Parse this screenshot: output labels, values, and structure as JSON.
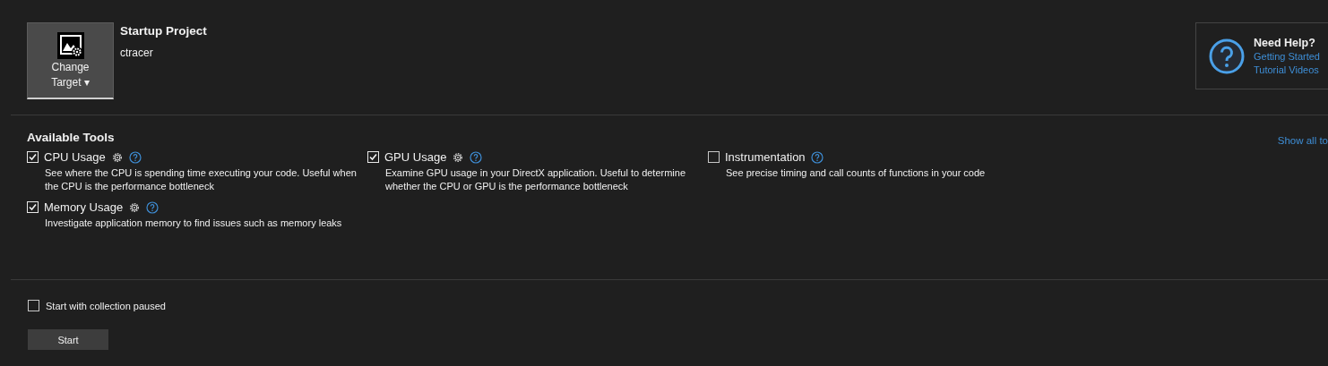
{
  "target": {
    "button_label_line1": "Change",
    "button_label_line2": "Target",
    "caret": "▾",
    "heading": "Startup Project",
    "project": "ctracer"
  },
  "help": {
    "title": "Need Help?",
    "links": [
      "Getting Started",
      "Tutorial Videos"
    ]
  },
  "tools_section": {
    "title": "Available Tools",
    "show_all_link": "Show all to"
  },
  "tools": [
    {
      "name": "CPU Usage",
      "checked": true,
      "has_settings": true,
      "description": "See where the CPU is spending time executing your code. Useful when the CPU is the performance bottleneck"
    },
    {
      "name": "GPU Usage",
      "checked": true,
      "has_settings": true,
      "description": "Examine GPU usage in your DirectX application. Useful to determine whether the CPU or GPU is the performance bottleneck"
    },
    {
      "name": "Instrumentation",
      "checked": false,
      "has_settings": false,
      "description": "See precise timing and call counts of functions in your code"
    },
    {
      "name": "Memory Usage",
      "checked": true,
      "has_settings": true,
      "description": "Investigate application memory to find issues such as memory leaks"
    }
  ],
  "pause_option": {
    "label": "Start with collection paused",
    "checked": false
  },
  "start_button": "Start"
}
